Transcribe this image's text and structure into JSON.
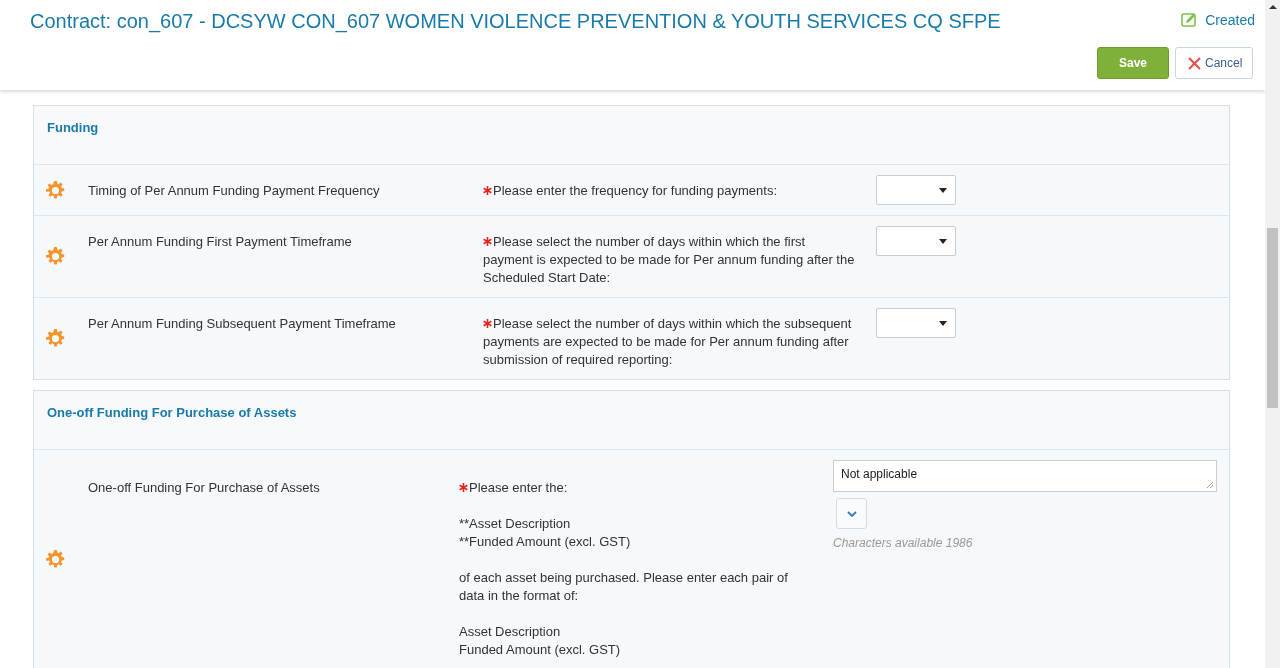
{
  "header": {
    "title": "Contract: con_607 - DCSYW CON_607 WOMEN VIOLENCE PREVENTION & YOUTH SERVICES CQ SFPE",
    "status": "Created",
    "save": "Save",
    "cancel": "Cancel"
  },
  "sections": [
    {
      "title": "Funding",
      "rows": [
        {
          "label": "Timing of Per Annum Funding Payment Frequency",
          "required": true,
          "prompt": [
            [
              "Please enter the frequency for funding payments:"
            ]
          ],
          "control": {
            "kind": "select"
          }
        },
        {
          "label": "Per Annum Funding First Payment Timeframe",
          "required": true,
          "prompt": [
            [
              "Please select the number of days within which the first payment is expected to be made for Per annum funding after the Scheduled Start Date:"
            ]
          ],
          "control": {
            "kind": "select"
          }
        },
        {
          "label": "Per Annum Funding Subsequent Payment Timeframe",
          "required": true,
          "prompt": [
            [
              "Please select the number of days within which the subsequent payments are expected to be made for Per annum funding after submission of required reporting:"
            ]
          ],
          "control": {
            "kind": "select"
          }
        }
      ]
    },
    {
      "title": "One-off Funding For Purchase of Assets",
      "rows": [
        {
          "label": "One-off Funding For Purchase of Assets",
          "required": true,
          "prompt": [
            [
              "Please enter the:"
            ],
            [
              "**Asset Description",
              "**Funded Amount (excl. GST)"
            ],
            [
              "of each asset being purchased. Please enter each pair of data in the format of:"
            ],
            [
              "Asset Description",
              "Funded Amount (excl. GST)"
            ]
          ],
          "control": {
            "kind": "textarea",
            "value": "Not applicable",
            "hint": "Characters available 1986"
          }
        }
      ]
    }
  ]
}
